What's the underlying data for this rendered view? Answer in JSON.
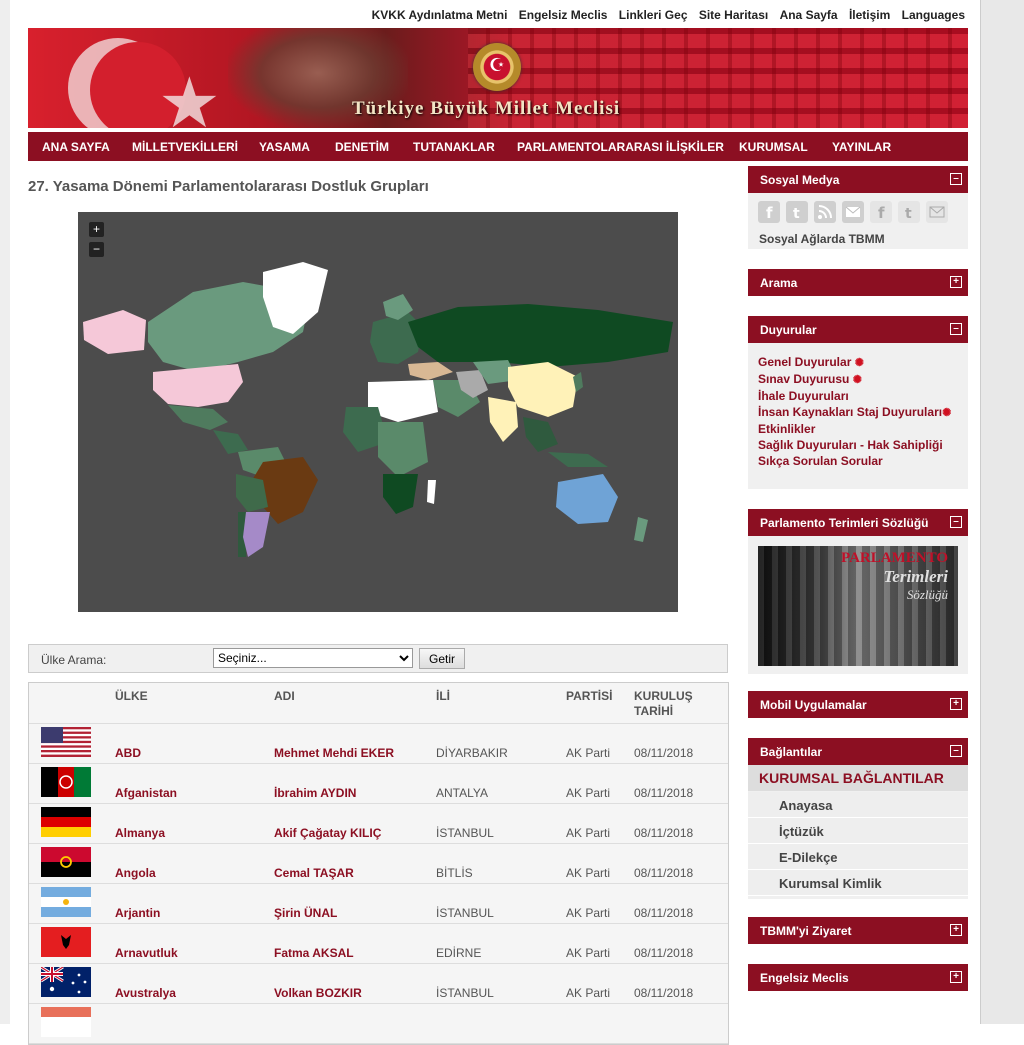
{
  "top_links": [
    "KVKK Aydınlatma Metni",
    "Engelsiz Meclis",
    "Linkleri Geç",
    "Site Haritası",
    "Ana Sayfa",
    "İletişim",
    "Languages"
  ],
  "banner": {
    "title": "Türkiye Büyük Millet Meclisi"
  },
  "main_nav": [
    "ANA SAYFA",
    "MİLLETVEKİLLERİ",
    "YASAMA",
    "DENETİM",
    "TUTANAKLAR",
    "PARLAMENTOLARARASI İLİŞKİLER",
    "KURUMSAL",
    "YAYINLAR"
  ],
  "page": {
    "title": "27. Yasama Dönemi Parlamentolararası Dostluk Grupları"
  },
  "map": {
    "zoom_in": "+",
    "zoom_out": "−"
  },
  "search": {
    "label": "Ülke Arama:",
    "selected": "Seçiniz...",
    "button": "Getir"
  },
  "table": {
    "headers": {
      "country": "ÜLKE",
      "name": "ADI",
      "city": "İLİ",
      "party": "PARTİSİ",
      "date_line1": "KURULUŞ",
      "date_line2": "TARİHİ"
    },
    "rows": [
      {
        "flag": "usa-flag",
        "country": "ABD",
        "name": "Mehmet Mehdi EKER",
        "city": "DİYARBAKIR",
        "party": "AK Parti",
        "date": "08/11/2018"
      },
      {
        "flag": "afghanistan-flag",
        "country": "Afganistan",
        "name": "İbrahim AYDIN",
        "city": "ANTALYA",
        "party": "AK Parti",
        "date": "08/11/2018"
      },
      {
        "flag": "germany-flag",
        "country": "Almanya",
        "name": "Akif Çağatay KILIÇ",
        "city": "İSTANBUL",
        "party": "AK Parti",
        "date": "08/11/2018"
      },
      {
        "flag": "angola-flag",
        "country": "Angola",
        "name": "Cemal TAŞAR",
        "city": "BİTLİS",
        "party": "AK Parti",
        "date": "08/11/2018"
      },
      {
        "flag": "argentina-flag",
        "country": "Arjantin",
        "name": "Şirin ÜNAL",
        "city": "İSTANBUL",
        "party": "AK Parti",
        "date": "08/11/2018"
      },
      {
        "flag": "albania-flag",
        "country": "Arnavutluk",
        "name": "Fatma AKSAL",
        "city": "EDİRNE",
        "party": "AK Parti",
        "date": "08/11/2018"
      },
      {
        "flag": "australia-flag",
        "country": "Avustralya",
        "name": "Volkan BOZKIR",
        "city": "İSTANBUL",
        "party": "AK Parti",
        "date": "08/11/2018"
      }
    ]
  },
  "sidebar": {
    "sosyal_medya": {
      "title": "Sosyal Medya",
      "caption": "Sosyal Ağlarda TBMM",
      "icons": [
        "facebook-icon",
        "twitter-icon",
        "rss-icon",
        "mail-icon",
        "facebook-icon",
        "twitter-icon",
        "mail-icon"
      ]
    },
    "arama": {
      "title": "Arama"
    },
    "duyurular": {
      "title": "Duyurular",
      "items": [
        "Genel Duyurular",
        "Sınav Duyurusu",
        "İhale Duyuruları",
        "İnsan Kaynakları Staj Duyuruları",
        "Etkinlikler",
        "Sağlık Duyuruları - Hak Sahipliği",
        "Sıkça Sorulan Sorular"
      ]
    },
    "sozluk": {
      "title": "Parlamento Terimleri Sözlüğü",
      "img_line1": "PARLAMENTO",
      "img_line2": "Terimleri",
      "img_line3": "Sözlüğü"
    },
    "mobil": {
      "title": "Mobil Uygulamalar"
    },
    "baglantilar": {
      "title": "Bağlantılar",
      "sub": "KURUMSAL BAĞLANTILAR",
      "items": [
        "Anayasa",
        "İçtüzük",
        "E-Dilekçe",
        "Kurumsal Kimlik"
      ]
    },
    "ziyaret": {
      "title": "TBMM'yi Ziyaret"
    },
    "engelsiz": {
      "title": "Engelsiz Meclis"
    }
  },
  "colors": {
    "brand": "#8c0f22",
    "map_bg": "#4c4c4c"
  }
}
